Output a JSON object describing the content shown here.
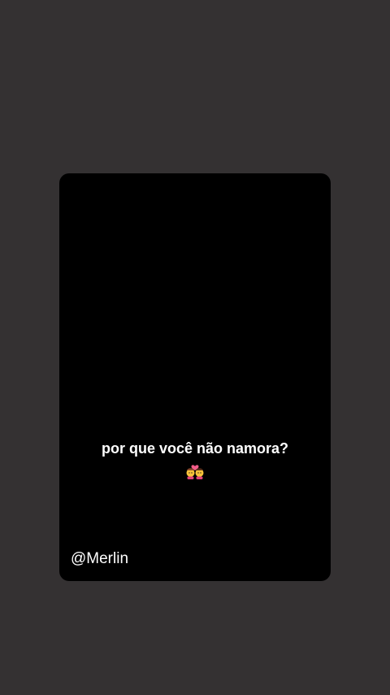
{
  "story": {
    "caption": "por que você não namora?",
    "emoji": "couple-with-heart-icon",
    "username": "@Merlin"
  },
  "colors": {
    "background": "#343132",
    "card": "#000000",
    "text": "#ffffff"
  }
}
